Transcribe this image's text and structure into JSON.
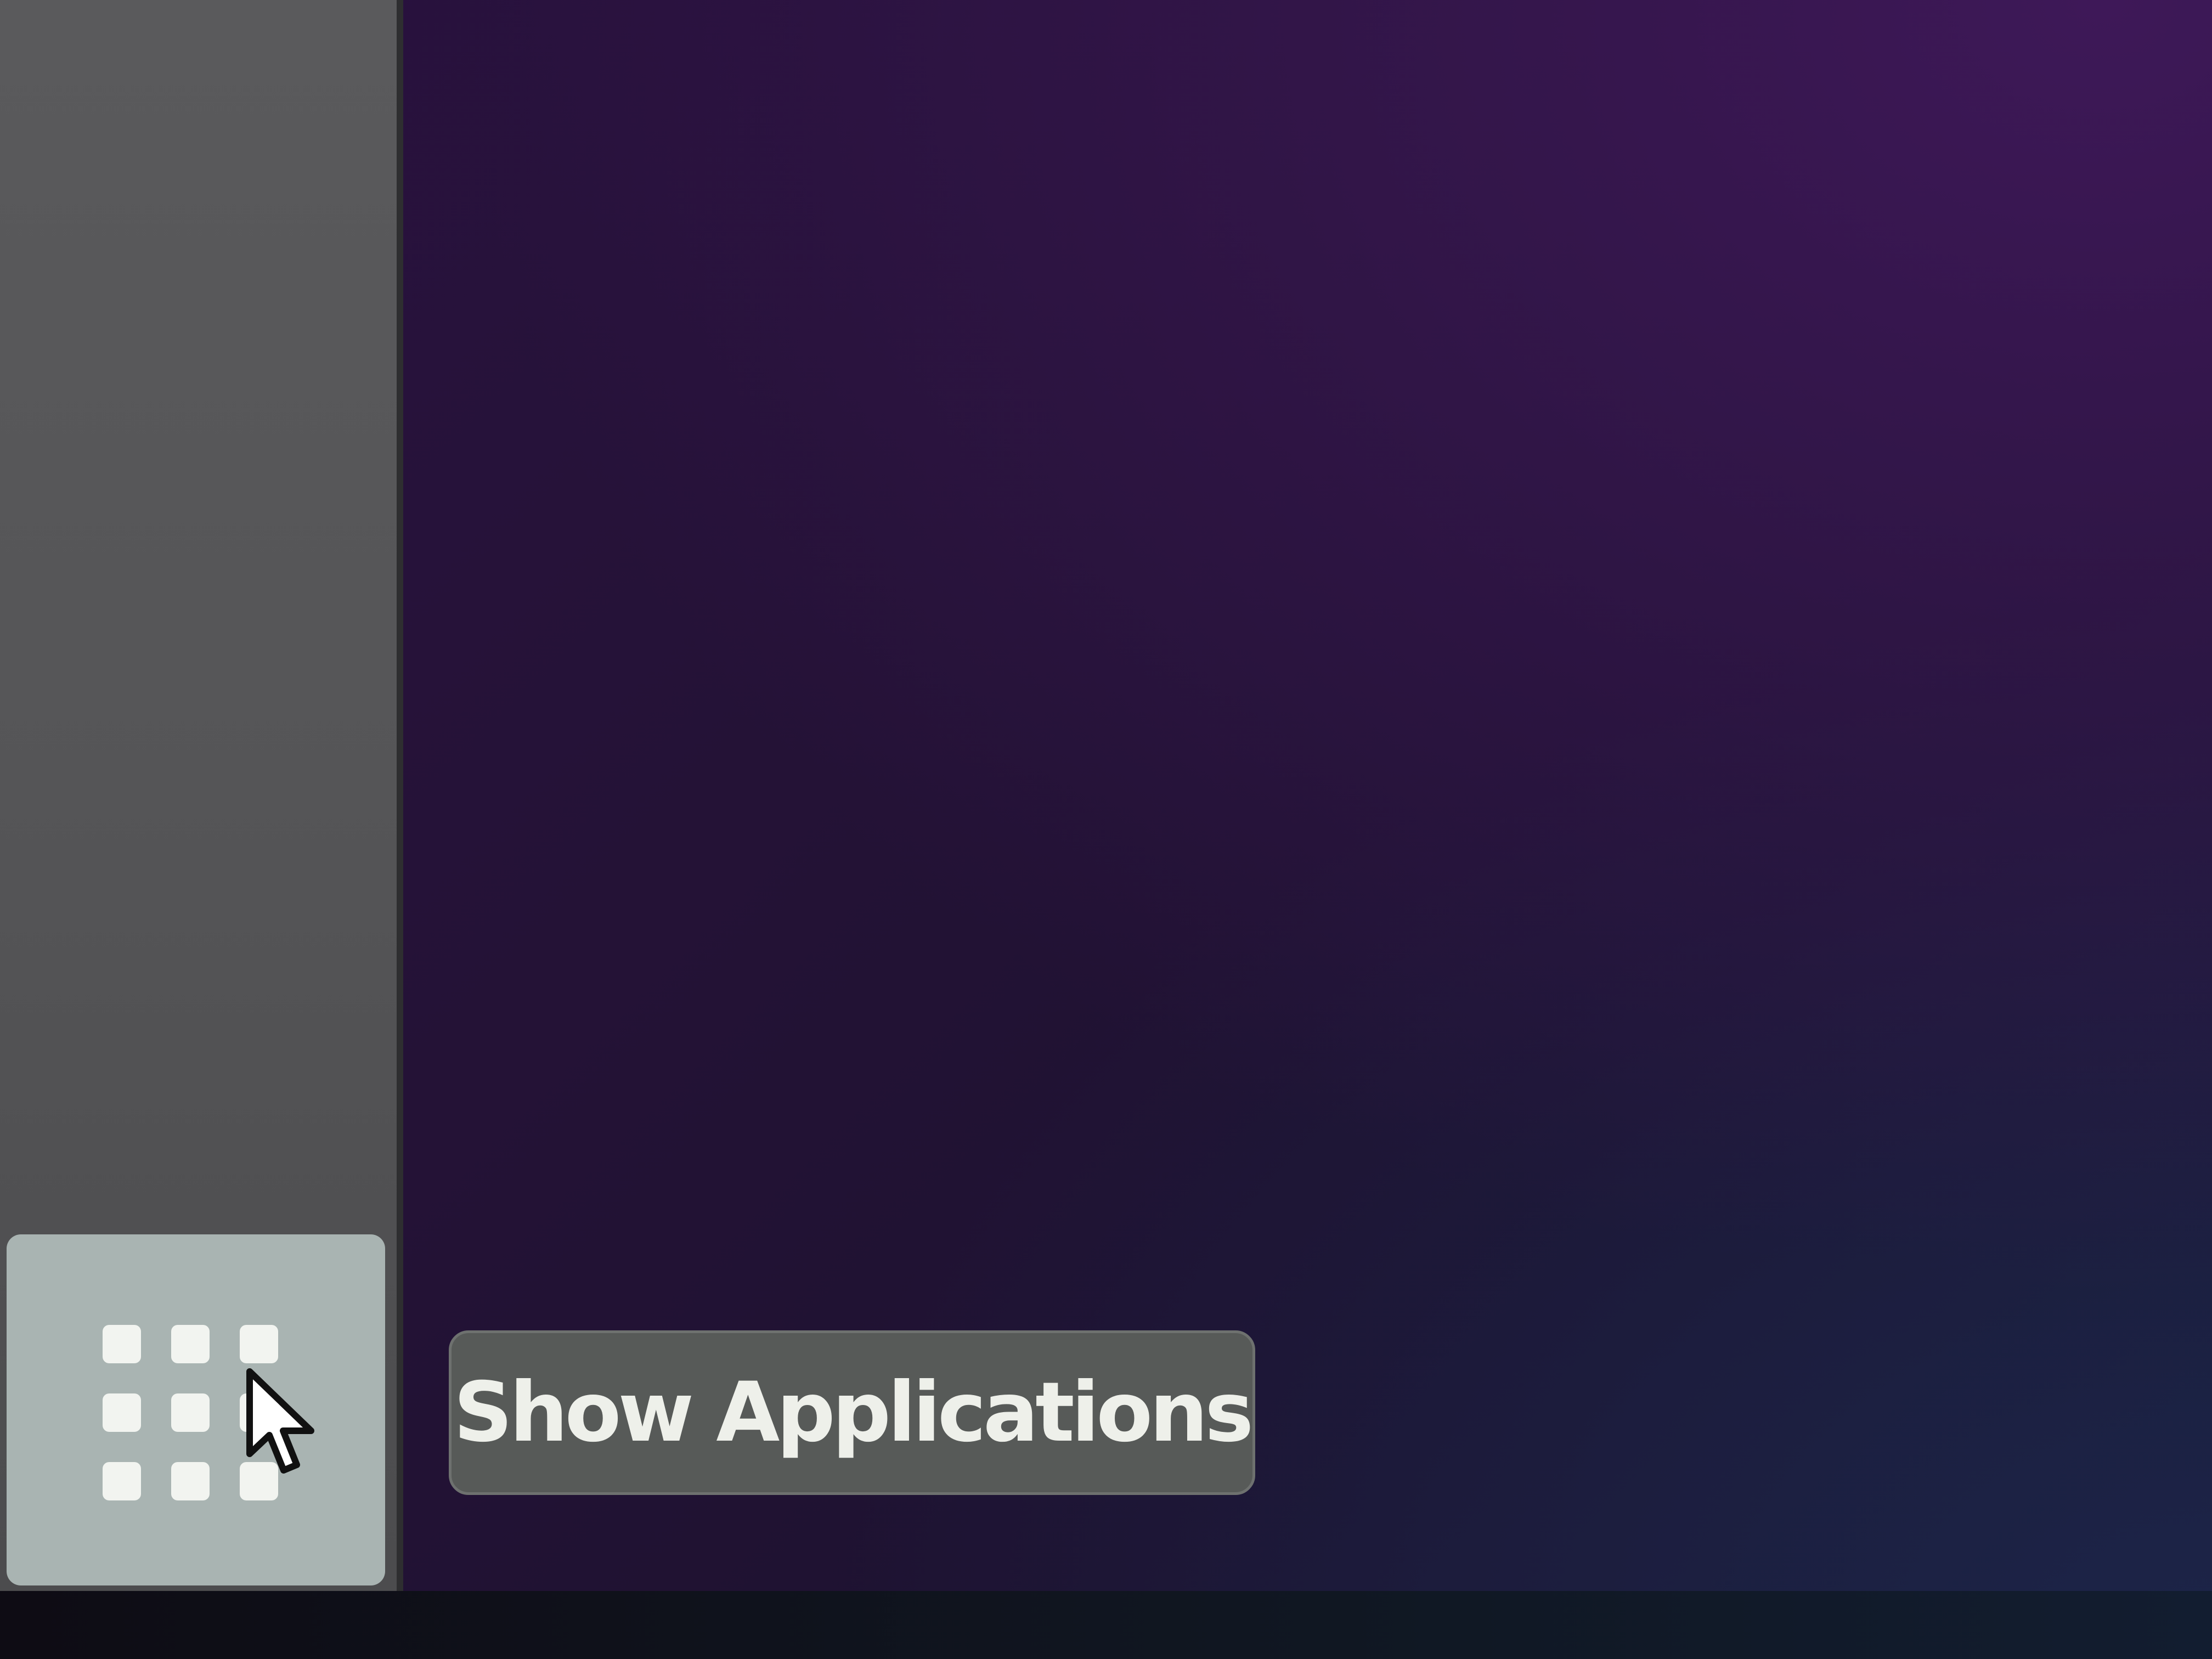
{
  "dock": {
    "show_applications": {
      "icon": "grid-icon",
      "tooltip": "Show Applications"
    }
  },
  "pointer": {
    "icon": "mouse-cursor-icon"
  },
  "colors": {
    "wallpaper_top_right": "#3e1858",
    "wallpaper_base": "#241236",
    "dock_background": "#555557",
    "button_hover": "#a9b4b2",
    "tooltip_background": "#575a58",
    "tooltip_text": "#eef0ea"
  }
}
